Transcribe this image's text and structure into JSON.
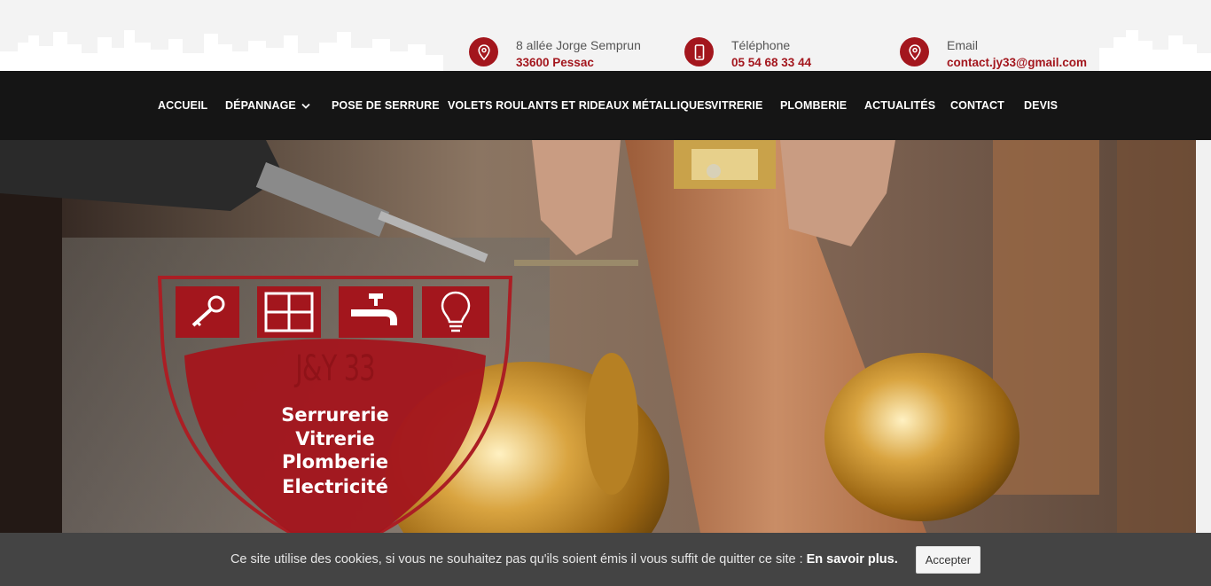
{
  "header": {
    "contacts": [
      {
        "icon": "location-pin-icon",
        "label": "8 allée Jorge Semprun",
        "value": "33600 Pessac"
      },
      {
        "icon": "mobile-phone-icon",
        "label": "Téléphone",
        "value": "05 54 68 33 44"
      },
      {
        "icon": "location-pin-icon",
        "label": "Email",
        "value": "contact.jy33@gmail.com"
      }
    ]
  },
  "nav": {
    "items": [
      {
        "label": "ACCUEIL"
      },
      {
        "label": "DÉPANNAGE",
        "has_dropdown": true
      },
      {
        "label": "POSE DE SERRURE"
      },
      {
        "label": "VOLETS ROULANTS ET RIDEAUX MÉTALLIQUES"
      },
      {
        "label": "VITRERIE"
      },
      {
        "label": "PLOMBERIE"
      },
      {
        "label": "ACTUALITÉS"
      },
      {
        "label": "CONTACT"
      },
      {
        "label": "DEVIS"
      }
    ]
  },
  "logo": {
    "brand": "J&Y 33",
    "services": [
      "Serrurerie",
      "Vitrerie",
      "Plomberie",
      "Electricité"
    ],
    "icons": [
      "key-icon",
      "window-icon",
      "faucet-icon",
      "lightbulb-icon"
    ]
  },
  "cookie_banner": {
    "message": "Ce site utilise des cookies, si vous ne souhaitez pas qu'ils soient émis il vous suffit de quitter ce site :",
    "more_link": "En savoir plus.",
    "accept_label": "Accepter"
  },
  "colors": {
    "brand_red": "#a3161d",
    "nav_bg": "#151515",
    "cookie_bg": "#444444"
  }
}
